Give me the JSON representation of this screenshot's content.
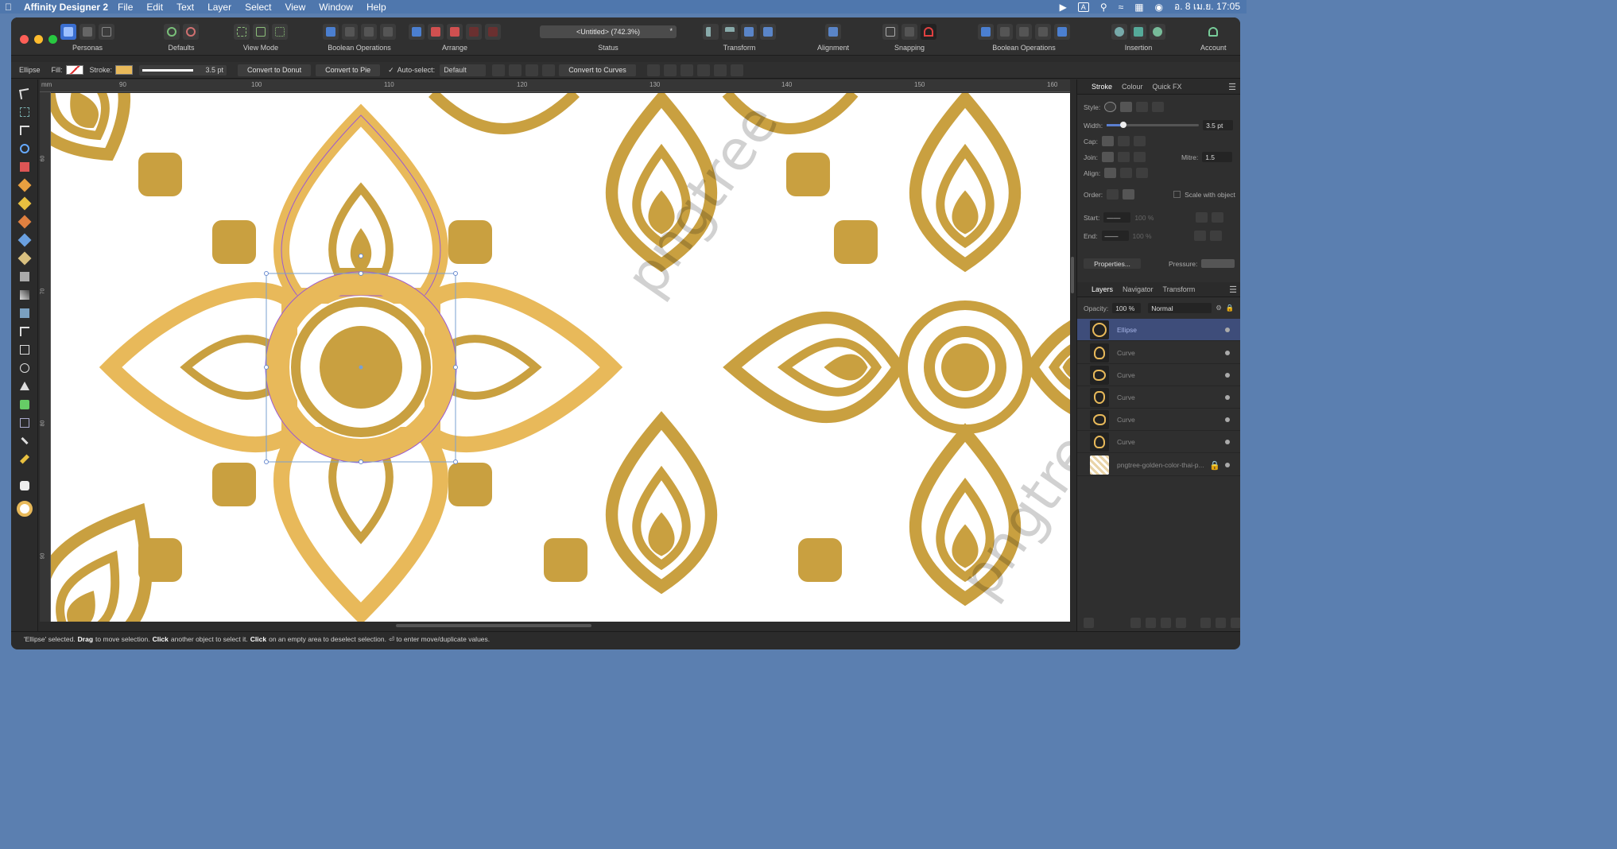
{
  "menubar": {
    "app_name": "Affinity Designer 2",
    "items": [
      "File",
      "Edit",
      "Text",
      "Layer",
      "Select",
      "View",
      "Window",
      "Help"
    ],
    "input_indicator": "A",
    "clock": "อ. 8 เม.ย.  17:05"
  },
  "toolbar": {
    "groups": [
      {
        "label": "Personas"
      },
      {
        "label": "Defaults"
      },
      {
        "label": "View Mode"
      },
      {
        "label": "Boolean Operations"
      },
      {
        "label": "Arrange"
      },
      {
        "label": "Status"
      },
      {
        "label": "Transform"
      },
      {
        "label": "Alignment"
      },
      {
        "label": "Snapping"
      },
      {
        "label": "Boolean Operations"
      },
      {
        "label": "Insertion"
      },
      {
        "label": "Account"
      }
    ],
    "document_title": "<Untitled> (742.3%)",
    "modified_mark": "*"
  },
  "context": {
    "object_type": "Ellipse",
    "fill_label": "Fill:",
    "stroke_label": "Stroke:",
    "stroke_width": "3.5 pt",
    "convert_donut": "Convert to Donut",
    "convert_pie": "Convert to Pie",
    "auto_select_label": "Auto-select:",
    "auto_select_value": "Default",
    "convert_curves": "Convert to Curves",
    "stroke_color": "#e8b95a"
  },
  "rulers": {
    "unit": "mm",
    "top": [
      "90",
      "100",
      "110",
      "120",
      "130",
      "140",
      "150",
      "160"
    ],
    "left": [
      "60",
      "70",
      "80",
      "90"
    ]
  },
  "stroke_panel": {
    "tabs": [
      "Stroke",
      "Colour",
      "Quick FX"
    ],
    "style_label": "Style:",
    "width_label": "Width:",
    "width_value": "3.5 pt",
    "width_fraction": 0.18,
    "cap_label": "Cap:",
    "join_label": "Join:",
    "mitre_label": "Mitre:",
    "mitre_value": "1.5",
    "align_label": "Align:",
    "order_label": "Order:",
    "scale_label": "Scale with object",
    "start_label": "Start:",
    "end_label": "End:",
    "start_pct": "100 %",
    "end_pct": "100 %",
    "properties_label": "Properties...",
    "pressure_label": "Pressure:"
  },
  "layers_panel": {
    "tabs": [
      "Layers",
      "Navigator",
      "Transform"
    ],
    "opacity_label": "Opacity:",
    "opacity_value": "100 %",
    "blend_mode": "Normal",
    "layers": [
      {
        "name": "Ellipse",
        "selected": true
      },
      {
        "name": "Curve",
        "selected": false
      },
      {
        "name": "Curve",
        "selected": false
      },
      {
        "name": "Curve",
        "selected": false
      },
      {
        "name": "Curve",
        "selected": false
      },
      {
        "name": "Curve",
        "selected": false
      },
      {
        "name": "pngtree-golden-color-thai-p...",
        "selected": false
      }
    ]
  },
  "status": {
    "selected": "'Ellipse' selected.",
    "drag": "Drag",
    "drag_text": "to move selection.",
    "click1": "Click",
    "click1_text": "another object to select it.",
    "click2": "Click",
    "click2_text": "on an empty area to deselect selection.",
    "enter_text": "⏎ to enter move/duplicate values."
  },
  "colors": {
    "gold": "#c9a040",
    "gold_light": "#e8b95a",
    "selection": "#9b59d0",
    "panel_bg": "#2f2f2f"
  },
  "watermark": "pngtree"
}
